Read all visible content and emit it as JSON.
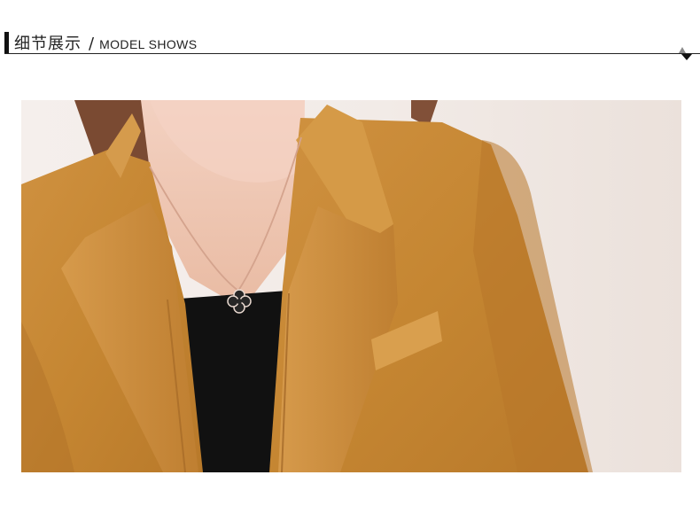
{
  "header": {
    "title_cn": "细节展示",
    "separator": "/",
    "title_en": "MODEL SHOWS"
  },
  "icons": {
    "corner_arrow": "triangle-arrow-icon"
  },
  "photo": {
    "subject": "model-photo",
    "colors": {
      "background": "#efe6e1",
      "jacket": "#c98a34",
      "jacket_shadow": "#a96d24",
      "shirt": "#111111",
      "skin": "#efc8b3",
      "hair": "#7a4a32"
    }
  }
}
